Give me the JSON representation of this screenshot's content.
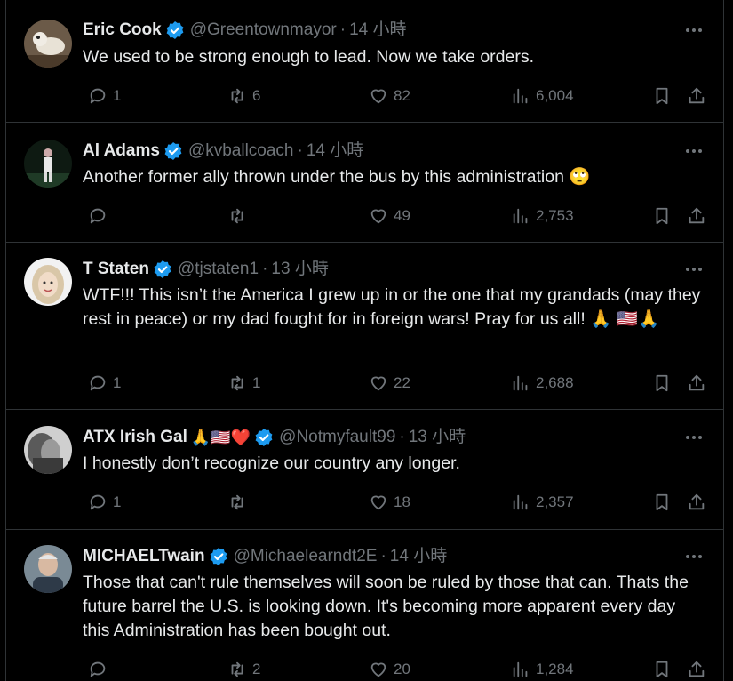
{
  "colors": {
    "background": "#000000",
    "text_primary": "#e7e9ea",
    "text_secondary": "#71767b",
    "verified": "#1d9bf0",
    "divider": "#2f3336"
  },
  "tweets": [
    {
      "name": "Eric Cook",
      "name_emoji": "",
      "handle": "@Greentownmayor",
      "time": "14 小時",
      "text": "We used to be strong enough to lead. Now we take orders.",
      "replies": "1",
      "retweets": "6",
      "likes": "82",
      "views": "6,004"
    },
    {
      "name": "Al Adams",
      "name_emoji": "",
      "handle": "@kvballcoach",
      "time": "14 小時",
      "text": "Another former ally thrown under the bus by this administration 🙄",
      "replies": "",
      "retweets": "",
      "likes": "49",
      "views": "2,753"
    },
    {
      "name": "T Staten",
      "name_emoji": "",
      "handle": "@tjstaten1",
      "time": "13 小時",
      "text": "WTF!!! This isn’t the America I grew up in or the one that my grandads (may they rest in peace) or my dad fought for in foreign wars! Pray for us all! 🙏 🇺🇸🙏",
      "replies": "1",
      "retweets": "1",
      "likes": "22",
      "views": "2,688"
    },
    {
      "name": "ATX Irish Gal",
      "name_emoji": "🙏🇺🇸❤️",
      "handle": "@Notmyfault99",
      "time": "13 小時",
      "text": "I honestly don’t recognize our country any longer.",
      "replies": "1",
      "retweets": "",
      "likes": "18",
      "views": "2,357"
    },
    {
      "name": "MICHAELTwain",
      "name_emoji": "",
      "handle": "@Michaelearndt2E",
      "time": "14 小時",
      "text": "Those that can't rule themselves will soon be ruled by those that can. Thats the future barrel the U.S. is looking down. It's becoming more apparent every day this Administration has been bought out.",
      "replies": "",
      "retweets": "2",
      "likes": "20",
      "views": "1,284"
    }
  ],
  "icons": [
    "avatar",
    "verified-badge-icon",
    "more-icon",
    "reply-icon",
    "retweet-icon",
    "like-icon",
    "views-icon",
    "bookmark-icon",
    "share-icon"
  ],
  "separator": "·"
}
